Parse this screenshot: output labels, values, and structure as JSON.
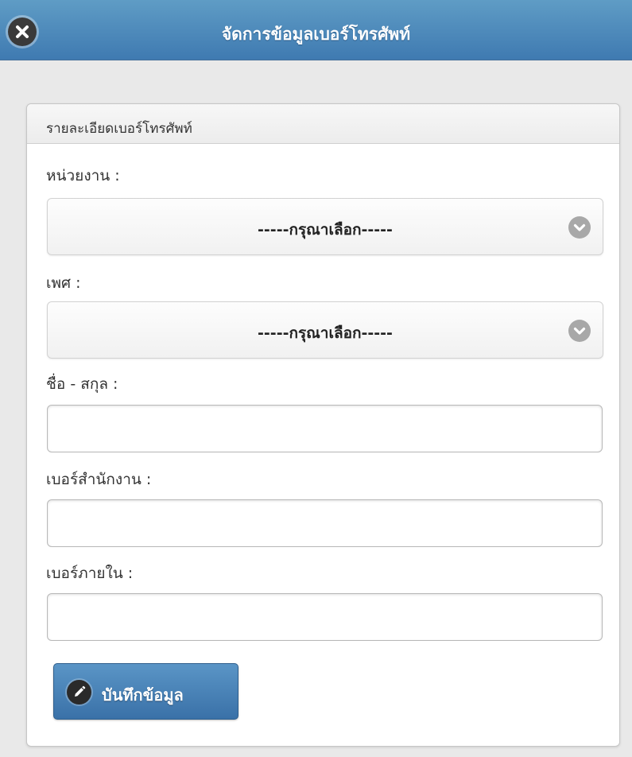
{
  "header": {
    "title": "จัดการข้อมูลเบอร์โทรศัพท์",
    "close_icon": "close-icon"
  },
  "panel": {
    "title": "รายละเอียดเบอร์โทรศัพท์"
  },
  "form": {
    "department": {
      "label": "หน่วยงาน :",
      "selected": "-----กรุณาเลือก-----"
    },
    "gender": {
      "label": "เพศ :",
      "selected": "-----กรุณาเลือก-----"
    },
    "fullname": {
      "label": "ชื่อ - สกุล :",
      "value": ""
    },
    "office_phone": {
      "label": "เบอร์สำนักงาน :",
      "value": ""
    },
    "internal_phone": {
      "label": "เบอร์ภายใน :",
      "value": ""
    },
    "save_button": {
      "label": "บันทึกข้อมูล",
      "icon": "pencil-icon"
    }
  },
  "colors": {
    "header_bg": "#4f89bc",
    "button_bg": "#4a83b8",
    "page_bg": "#e9e9e9"
  }
}
